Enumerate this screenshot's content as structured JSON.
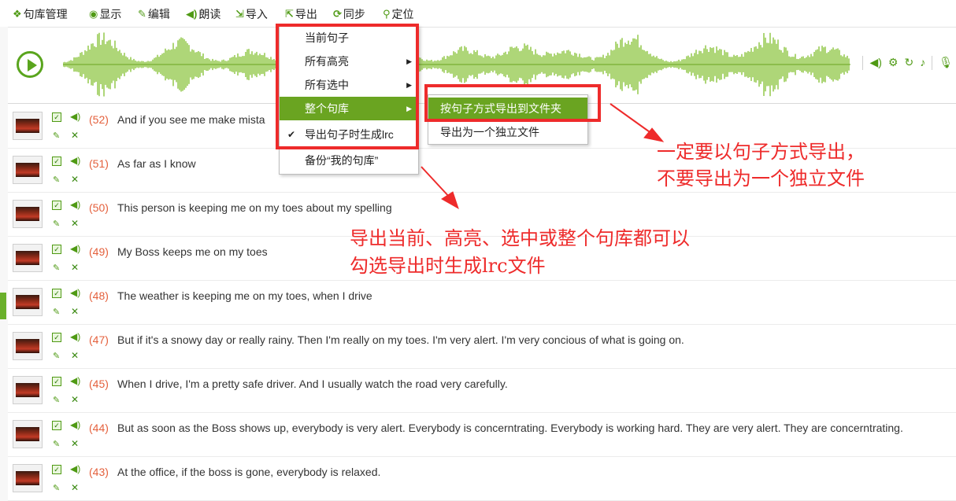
{
  "menubar": {
    "items": [
      {
        "icon": "library-icon",
        "label": "句库管理"
      },
      {
        "icon": "eye-icon",
        "label": "显示"
      },
      {
        "icon": "edit-icon",
        "label": "编辑"
      },
      {
        "icon": "speaker-icon",
        "label": "朗读"
      },
      {
        "icon": "import-icon",
        "label": "导入"
      },
      {
        "icon": "export-icon",
        "label": "导出"
      },
      {
        "icon": "sync-icon",
        "label": "同步"
      },
      {
        "icon": "locate-icon",
        "label": "定位"
      }
    ]
  },
  "wave_tools": [
    "speaker-icon",
    "gear-icon",
    "refresh-icon",
    "bell-icon",
    "mic-icon"
  ],
  "dropdown": {
    "items": [
      {
        "label": "当前句子",
        "has_submenu": false,
        "checked": false,
        "active": false
      },
      {
        "label": "所有高亮",
        "has_submenu": true,
        "checked": false,
        "active": false
      },
      {
        "label": "所有选中",
        "has_submenu": true,
        "checked": false,
        "active": false
      },
      {
        "label": "整个句库",
        "has_submenu": true,
        "checked": false,
        "active": true
      },
      {
        "label": "导出句子时生成lrc",
        "has_submenu": false,
        "checked": true,
        "active": false
      },
      {
        "label": "备份“我的句库”",
        "has_submenu": false,
        "checked": false,
        "active": false
      }
    ]
  },
  "submenu": {
    "items": [
      {
        "label": "按句子方式导出到文件夹",
        "active": true
      },
      {
        "label": "导出为一个独立文件",
        "active": false
      }
    ]
  },
  "sentences": [
    {
      "num": "(52)",
      "text": "And if you see me make mista"
    },
    {
      "num": "(51)",
      "text": "As far as I know"
    },
    {
      "num": "(50)",
      "text": "This person is keeping me on my toes about my spelling"
    },
    {
      "num": "(49)",
      "text": "My Boss keeps me on my toes"
    },
    {
      "num": "(48)",
      "text": "The weather is keeping me on my toes, when I drive"
    },
    {
      "num": "(47)",
      "text": "But if it's a snowy day or really rainy. Then I'm really on my toes. I'm very alert. I'm very concious of what is going on."
    },
    {
      "num": "(45)",
      "text": "When I drive, I'm a pretty safe driver. And I usually watch the road very carefully."
    },
    {
      "num": "(44)",
      "text": "But as soon as the Boss shows up, everybody is very alert. Everybody is concerntrating. Everybody is working hard. They are very alert. They are concerntrating."
    },
    {
      "num": "(43)",
      "text": "At the office, if the boss is gone, everybody is relaxed."
    }
  ],
  "annotations": {
    "right_line1": "一定要以句子方式导出，",
    "right_line2": "不要导出为一个独立文件",
    "center_line1": "导出当前、高亮、选中或整个句库都可以",
    "center_line2": "勾选导出时生成lrc文件"
  },
  "colors": {
    "accent_green": "#5aa51e",
    "menu_active": "#6aa421",
    "annotation_red": "#ee2b2b",
    "number_orange": "#e4603c"
  }
}
